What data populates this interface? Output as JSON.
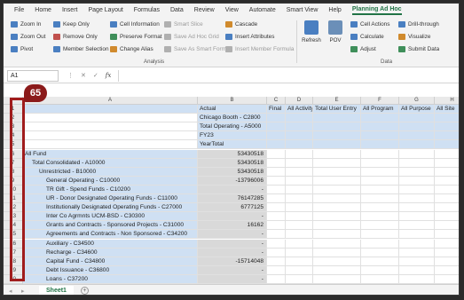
{
  "ribbon": {
    "tabs": [
      "File",
      "Home",
      "Insert",
      "Page Layout",
      "Formulas",
      "Data",
      "Review",
      "View",
      "Automate",
      "Smart View",
      "Help",
      "Planning Ad Hoc"
    ],
    "analysis": {
      "col1": [
        "Zoom In",
        "Zoom Out",
        "Pivot"
      ],
      "col2": [
        "Keep Only",
        "Remove Only",
        "Member Selection"
      ],
      "col3": [
        "Cell Information",
        "Preserve Format",
        "Change Alias"
      ],
      "col4": [
        "Smart Slice",
        "Save Ad Hoc Grid",
        "Save As Smart Form"
      ],
      "col5": [
        "Cascade",
        "Insert Attributes",
        "Insert Member Formula"
      ],
      "label": "Analysis"
    },
    "data_group": {
      "refresh": "Refresh",
      "pov": "POV",
      "col1": [
        "Cell Actions",
        "Calculate",
        "Adjust"
      ],
      "col2": [
        "Drill-through",
        "Visualize",
        "Submit Data"
      ],
      "label": "Data"
    }
  },
  "formula_bar": {
    "name_box": "A1",
    "formula": ""
  },
  "columns": [
    "A",
    "B",
    "C",
    "D",
    "E",
    "F",
    "G",
    "H"
  ],
  "rows": [
    {
      "n": "1",
      "a": "",
      "b": "Actual",
      "c": "Final",
      "d": "All Activity",
      "e": "Total User Entry",
      "f": "All Program",
      "g": "All Purpose",
      "h": "All Site"
    },
    {
      "n": "2",
      "a": "",
      "b": "Chicago Booth - C2800"
    },
    {
      "n": "3",
      "a": "",
      "b": "Total Operating - A5000"
    },
    {
      "n": "4",
      "a": "",
      "b": "FY23"
    },
    {
      "n": "5",
      "a": "",
      "b": "YearTotal"
    },
    {
      "n": "6",
      "a": "All Fund",
      "b": "53430518",
      "indent": 0
    },
    {
      "n": "7",
      "a": "Total Consolidated - A10000",
      "b": "53430518",
      "indent": 1
    },
    {
      "n": "8",
      "a": "Unrestricted - B10000",
      "b": "53430518",
      "indent": 2
    },
    {
      "n": "9",
      "a": "General Operating - C10000",
      "b": "-13796006",
      "indent": 3
    },
    {
      "n": "10",
      "a": "TR Gift - Spend Funds - C10200",
      "b": "-",
      "indent": 3
    },
    {
      "n": "11",
      "a": "UR - Donor Designated Operating Funds - C11000",
      "b": "76147285",
      "indent": 3
    },
    {
      "n": "12",
      "a": "Institutionally Designated Operating Funds - C27000",
      "b": "6777125",
      "indent": 3
    },
    {
      "n": "13",
      "a": "Inter Co Agrmnts UCM-BSD - C30300",
      "b": "-",
      "indent": 3
    },
    {
      "n": "14",
      "a": "Grants and Contracts - Sponsored Projects - C31000",
      "b": "16162",
      "indent": 3
    },
    {
      "n": "15",
      "a": "Agreements and Contracts - Non Sponsored - C34200",
      "b": "-",
      "indent": 3
    },
    {
      "n": "16",
      "a": "Auxiliary - C34500",
      "b": "-",
      "indent": 3
    },
    {
      "n": "17",
      "a": "Recharge - C34600",
      "b": "-",
      "indent": 3
    },
    {
      "n": "18",
      "a": "Capital Fund - C34800",
      "b": "-15714048",
      "indent": 3
    },
    {
      "n": "19",
      "a": "Debt Issuance - C36800",
      "b": "-",
      "indent": 3
    },
    {
      "n": "20",
      "a": "Loans - C37200",
      "b": "-",
      "indent": 3
    }
  ],
  "sheet_tabs": {
    "active": "Sheet1",
    "add": "+"
  },
  "step_marker": "65",
  "colors": {
    "accent": "#217346",
    "marker": "#8b1a1a",
    "blue_cell": "#cfe0f3",
    "gray_cell": "#d9d9d9"
  }
}
